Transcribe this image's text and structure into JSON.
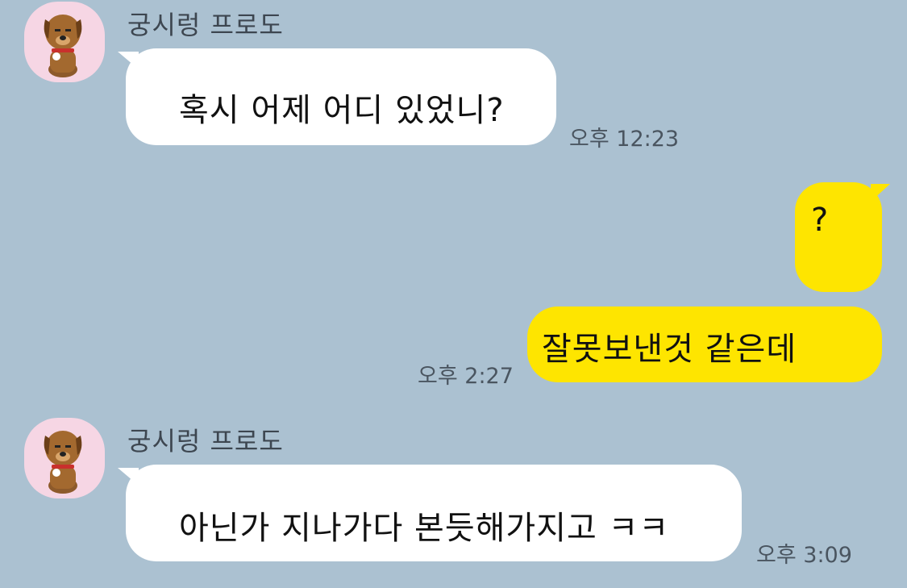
{
  "chat": {
    "messages": [
      {
        "sender": "궁시렁 프로도",
        "text": "혹시 어제 어디 있었니?",
        "time": "오후 12:23",
        "direction": "incoming"
      },
      {
        "sender": "",
        "text": "?",
        "time": "",
        "direction": "outgoing"
      },
      {
        "sender": "",
        "text": "잘못보낸것 같은데",
        "time": "오후 2:27",
        "direction": "outgoing"
      },
      {
        "sender": "궁시렁 프로도",
        "text": "아닌가 지나가다 본듯해가지고 ㅋㅋ",
        "time": "오후 3:09",
        "direction": "incoming"
      }
    ]
  },
  "colors": {
    "background": "#abc1d1",
    "incoming_bubble": "#ffffff",
    "outgoing_bubble": "#fee500",
    "avatar_bg": "#f6d6e4"
  },
  "icons": {
    "avatar": "brown-dog-character-icon"
  }
}
